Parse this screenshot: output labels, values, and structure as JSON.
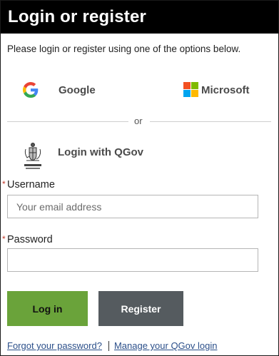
{
  "header": {
    "title": "Login or register"
  },
  "instruction": "Please login or register using one of the options below.",
  "providers": {
    "google": {
      "label": "Google",
      "icon": "google-icon"
    },
    "microsoft": {
      "label": "Microsoft",
      "icon": "microsoft-icon"
    },
    "divider": "or",
    "qgov": {
      "label": "Login with QGov",
      "icon": "queensland-crest-icon"
    }
  },
  "form": {
    "required_marker": "*",
    "username": {
      "label": "Username",
      "value": "",
      "placeholder": "Your email address"
    },
    "password": {
      "label": "Password",
      "value": "",
      "placeholder": ""
    }
  },
  "buttons": {
    "login": "Log in",
    "register": "Register"
  },
  "links": {
    "forgot": "Forgot your password?",
    "manage": "Manage your QGov login"
  },
  "colors": {
    "header_bg": "#000000",
    "login_button": "#6aa33a",
    "register_button": "#555b5f",
    "link": "#2b4f8a",
    "required": "#c0392b"
  }
}
